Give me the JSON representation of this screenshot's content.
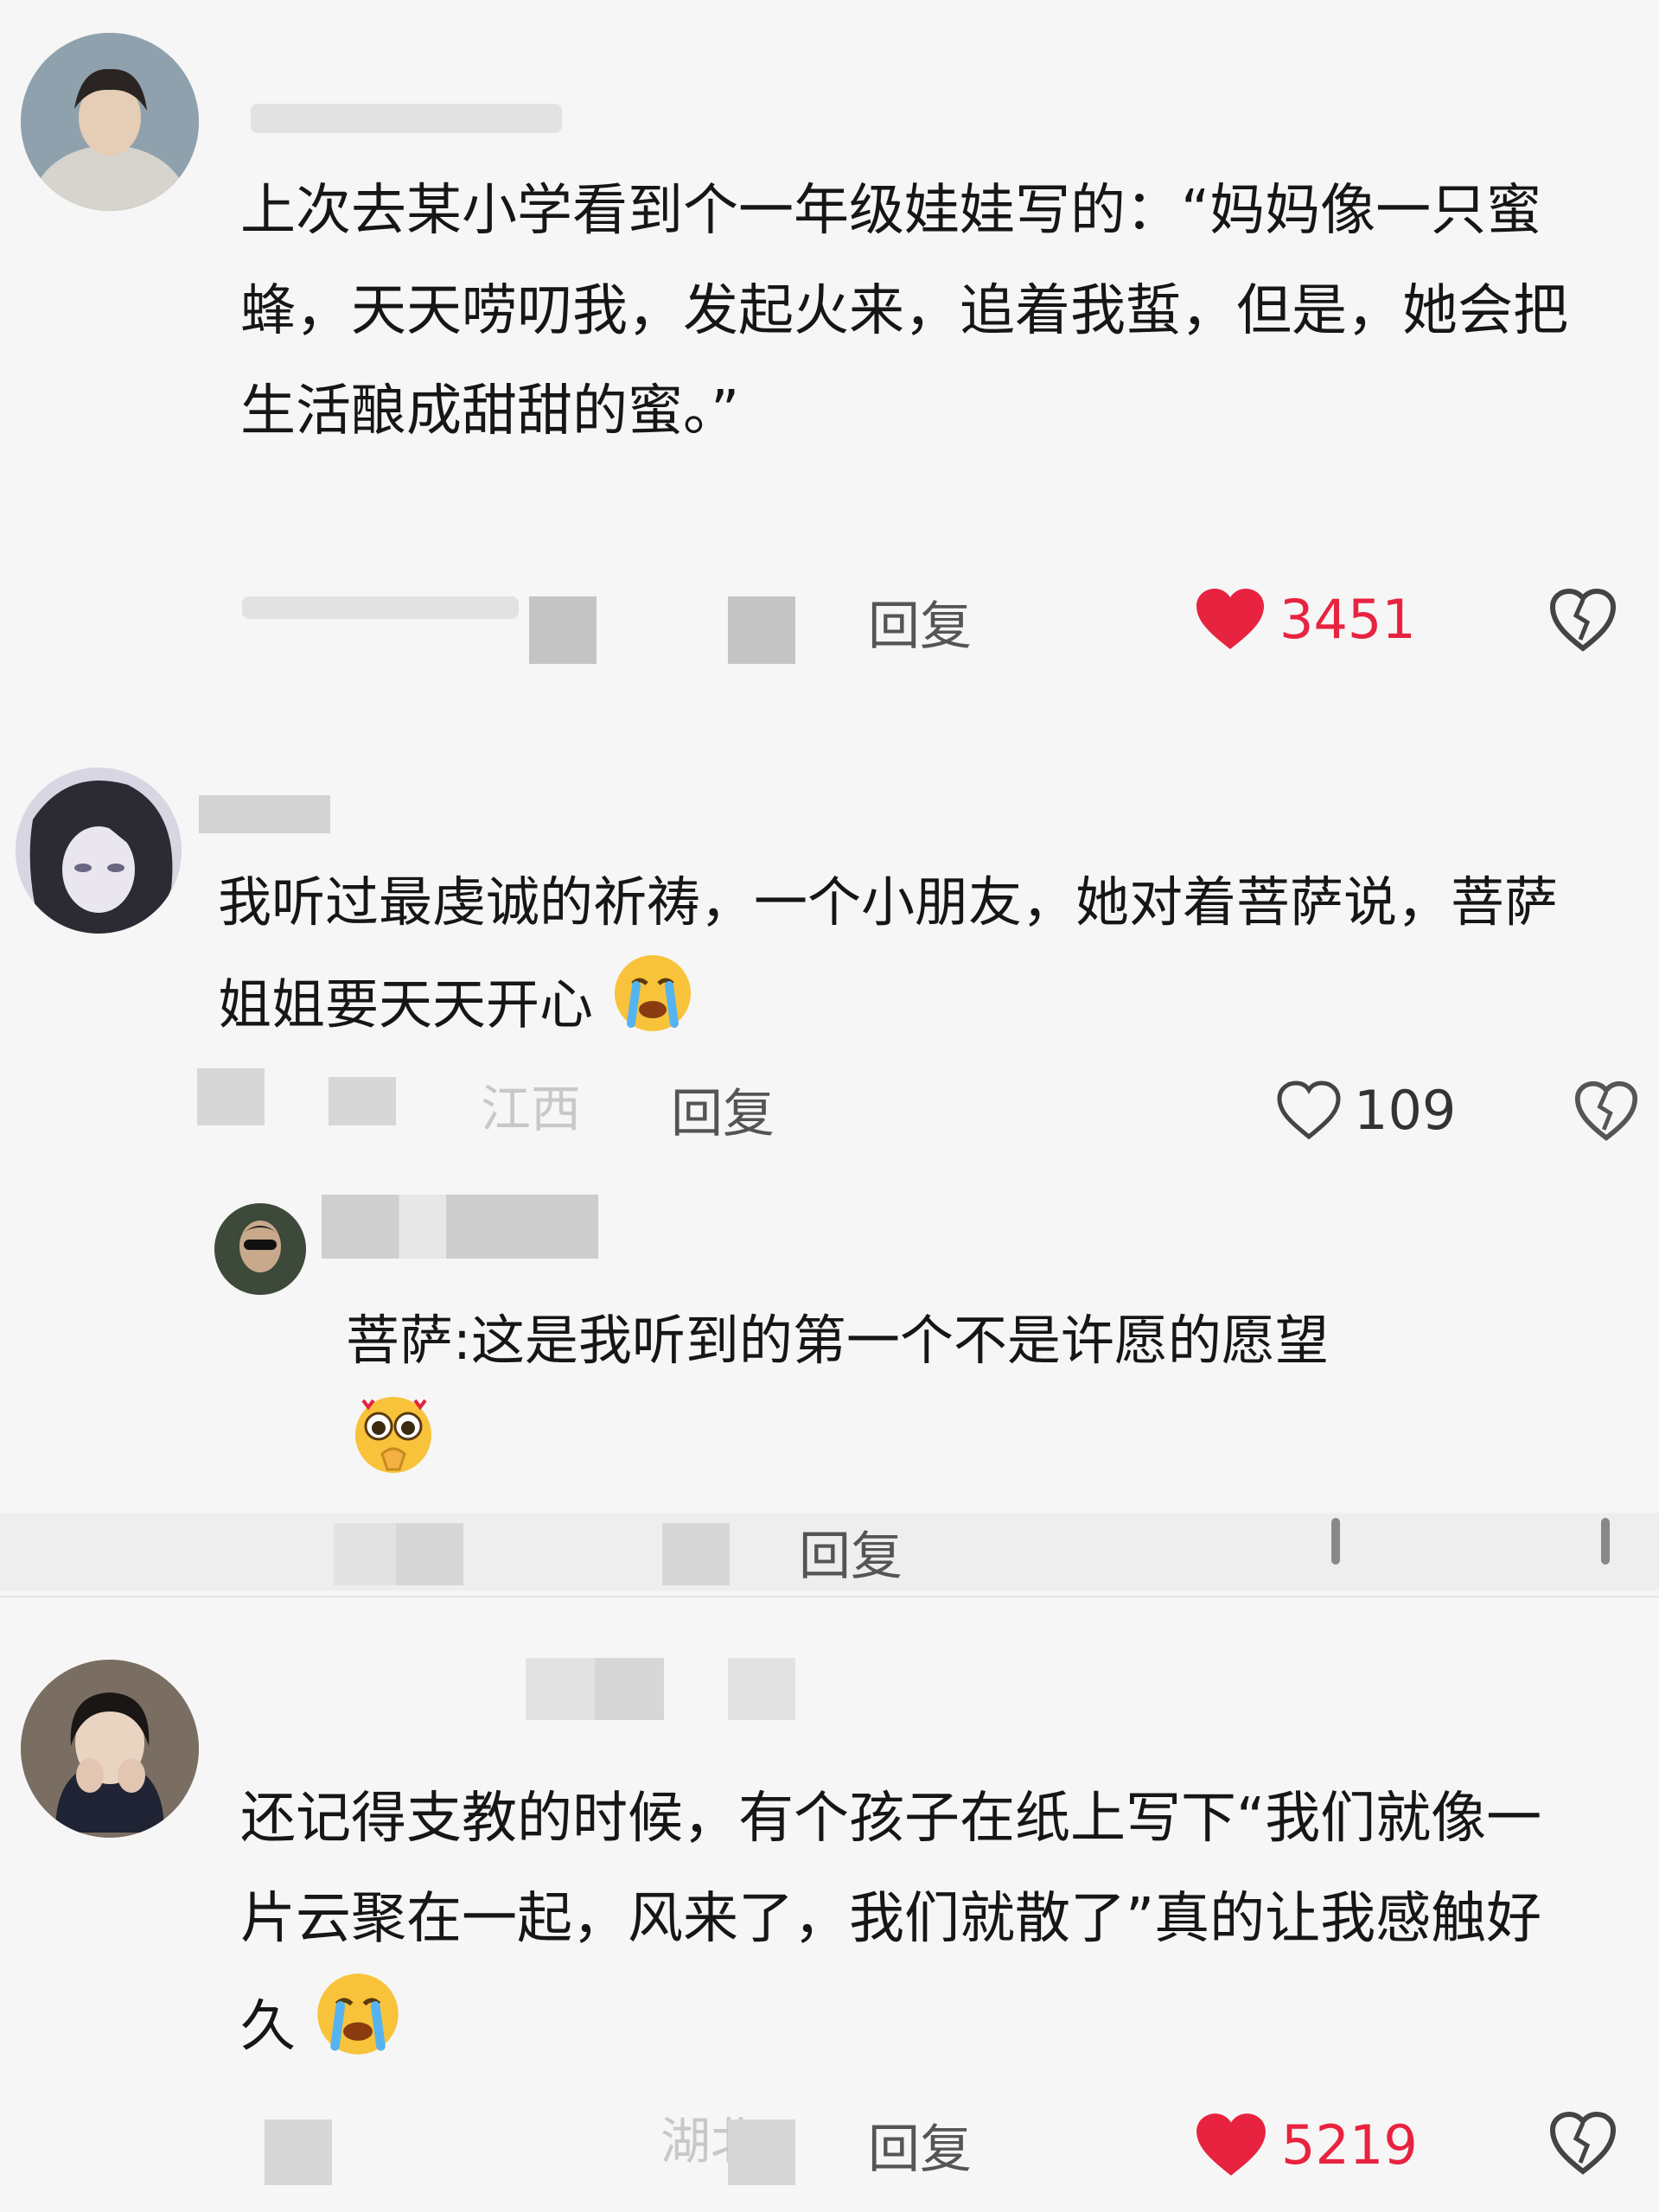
{
  "comments": [
    {
      "text": "上次去某小学看到个一年级娃娃写的：“妈妈像一只蜜蜂，天天唠叨我，发起火来，追着我蜇，但是，她会把生活酿成甜甜的蜜。”",
      "reply_label": "回复",
      "likes": "3451",
      "liked": true
    },
    {
      "text": "我听过最虔诚的祈祷，一个小朋友，她对着菩萨说，菩萨姐姐要天天开心",
      "meta_fragment": "江西",
      "reply_label": "回复",
      "likes": "109",
      "liked": false,
      "reply": {
        "text": "菩萨:这是我听到的第一个不是许愿的愿望",
        "reply_label": "回复"
      }
    },
    {
      "text": "还记得支教的时候，有个孩子在纸上写下“我们就像一片云聚在一起，风来了，我们就散了”真的让我感触好久",
      "meta_fragment": "湖北",
      "reply_label": "回复",
      "likes": "5219",
      "liked": true
    }
  ],
  "colors": {
    "like_red": "#e8233f",
    "text": "#161616",
    "meta_gray": "#555555",
    "background": "#f6f6f6"
  },
  "icons": [
    "heart-filled-icon",
    "heart-outline-icon",
    "broken-heart-icon",
    "crying-emoji",
    "pleading-emoji"
  ]
}
